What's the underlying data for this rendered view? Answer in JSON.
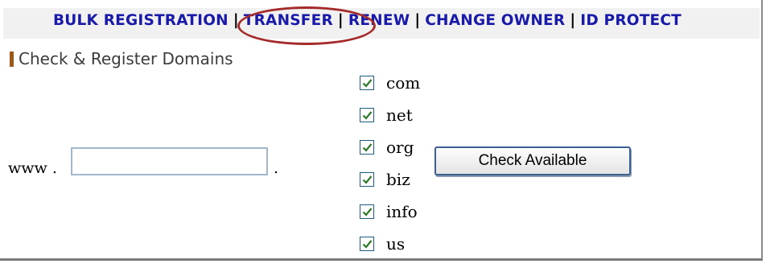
{
  "nav": {
    "items": [
      {
        "label": "BULK REGISTRATION"
      },
      {
        "label": "TRANSFER"
      },
      {
        "label": "RENEW"
      },
      {
        "label": "CHANGE OWNER"
      },
      {
        "label": "ID PROTECT"
      }
    ],
    "separator": "|",
    "highlighted": "TRANSFER",
    "highlight_color": "#a52a2a",
    "link_color": "#1a1aa8"
  },
  "section": {
    "title": "Check & Register Domains",
    "accent_color": "#a0581a"
  },
  "form": {
    "prefix": "www .",
    "input_value": "",
    "suffix": ".",
    "tlds": [
      {
        "label": "com",
        "checked": true
      },
      {
        "label": "net",
        "checked": true
      },
      {
        "label": "org",
        "checked": true
      },
      {
        "label": "biz",
        "checked": true
      },
      {
        "label": "info",
        "checked": true
      },
      {
        "label": "us",
        "checked": true
      }
    ],
    "submit_label": "Check Available"
  }
}
